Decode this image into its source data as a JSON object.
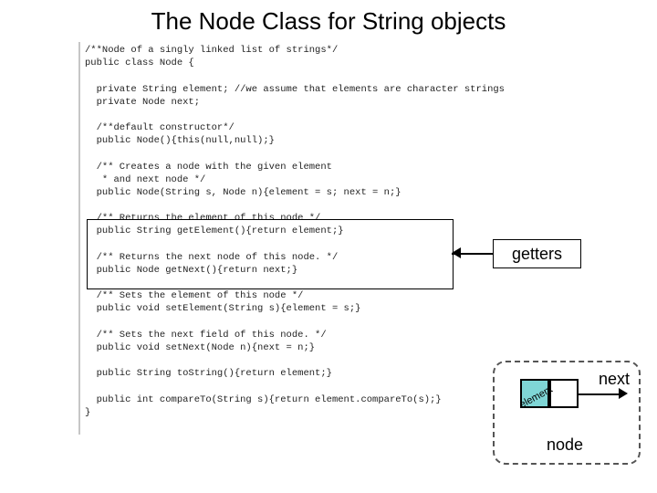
{
  "title": "The Node Class for String objects",
  "code": "/**Node of a singly linked list of strings*/\npublic class Node {\n\n  private String element; //we assume that elements are character strings\n  private Node next;\n\n  /**default constructor*/\n  public Node(){this(null,null);}\n\n  /** Creates a node with the given element\n   * and next node */\n  public Node(String s, Node n){element = s; next = n;}\n\n  /** Returns the element of this node */\n  public String getElement(){return element;}\n\n  /** Returns the next node of this node. */\n  public Node getNext(){return next;}\n\n  /** Sets the element of this node */\n  public void setElement(String s){element = s;}\n\n  /** Sets the next field of this node. */\n  public void setNext(Node n){next = n;}\n\n  public String toString(){return element;}\n\n  public int compareTo(String s){return element.compareTo(s);}\n}",
  "labels": {
    "getters": "getters",
    "next": "next",
    "node": "node",
    "element": "element"
  }
}
